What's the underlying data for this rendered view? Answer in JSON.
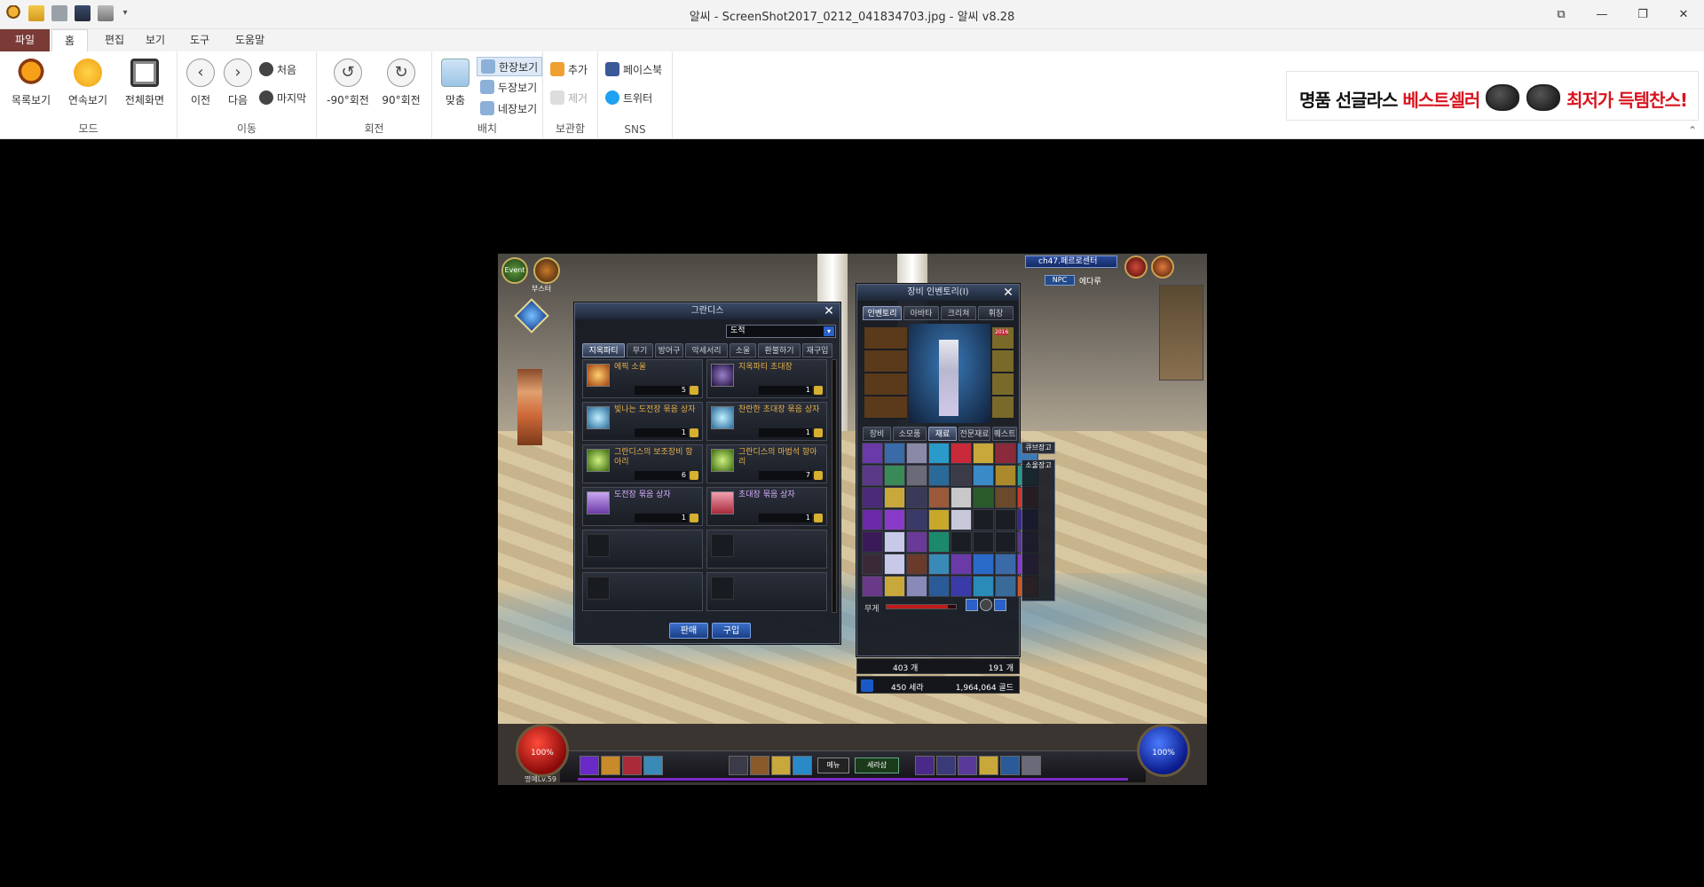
{
  "window": {
    "title": "알씨 - ScreenShot2017_0212_041834703.jpg - 알씨 v8.28",
    "controls": {
      "restore": "⧉",
      "minimize": "—",
      "maximize": "❐",
      "close": "✕"
    }
  },
  "menu_tabs": [
    "파일",
    "홈",
    "편집",
    "보기",
    "도구",
    "도움말"
  ],
  "ribbon": {
    "mode": {
      "label": "모드",
      "buttons": [
        "목록보기",
        "연속보기",
        "전체화면"
      ]
    },
    "move": {
      "label": "이동",
      "prev": "이전",
      "next": "다음",
      "first": "처음",
      "last": "마지막"
    },
    "rotate": {
      "label": "회전",
      "ccw": "-90°회전",
      "cw": "90°회전"
    },
    "layout": {
      "label": "배치",
      "fit": "맞춤",
      "one": "한장보기",
      "two": "두장보기",
      "four": "네장보기"
    },
    "box": {
      "label": "보관함",
      "add": "추가",
      "remove": "제거"
    },
    "sns": {
      "label": "SNS",
      "facebook": "페이스북",
      "twitter": "트위터"
    }
  },
  "ad": {
    "left_a": "명품 선글라스 ",
    "left_b": "베스트셀러",
    "right": "최저가 득템찬스!"
  },
  "colors": {
    "file_tab": "#7a3a36",
    "ad_red": "#d8141e",
    "ribbon_bg": "#ffffff"
  },
  "game": {
    "event": "Event",
    "booster": "부스터",
    "channel": "ch47.페르로센터",
    "npc": "NPC",
    "npc_name": "에다루",
    "hp": "100%",
    "mp": "100%",
    "level": "명예Lv.59",
    "menu_btn": "메뉴",
    "shop_btn": "세라샵",
    "shop": {
      "title": "그란디스",
      "dropdown": "도적",
      "tabs": [
        "지옥파티",
        "무기",
        "방어구",
        "악세서리",
        "소울",
        "환불하기",
        "재구입"
      ],
      "items": [
        {
          "name": "에픽 소울",
          "price": "5"
        },
        {
          "name": "지옥파티 초대장",
          "price": "1"
        },
        {
          "name": "빛나는 도전장 묶음 상자",
          "price": "1"
        },
        {
          "name": "찬란한 초대장 묶음 상자",
          "price": "1"
        },
        {
          "name": "그란디스의 보조장비 항아리",
          "price": "6"
        },
        {
          "name": "그란디스의 마법석 항아리",
          "price": "7"
        },
        {
          "name": "도전장 묶음 상자",
          "price": "1"
        },
        {
          "name": "초대장 묶음 상자",
          "price": "1"
        }
      ],
      "sell": "판매",
      "buy": "구입"
    },
    "inventory": {
      "title": "장비 인벤토리(I)",
      "top_tabs": [
        "인벤토리",
        "아바타",
        "크리쳐",
        "휘장"
      ],
      "bottom_tabs": [
        "장비",
        "소모품",
        "재료",
        "전문재료",
        "퀘스트"
      ],
      "side_tab": "소울장고",
      "weight_label": "무게",
      "count_a": "403 개",
      "count_b": "191 개",
      "cera": "450 세라",
      "gold": "1,964,064 골드",
      "badge": "2016"
    },
    "side_buttons": [
      "큐브장고"
    ]
  }
}
